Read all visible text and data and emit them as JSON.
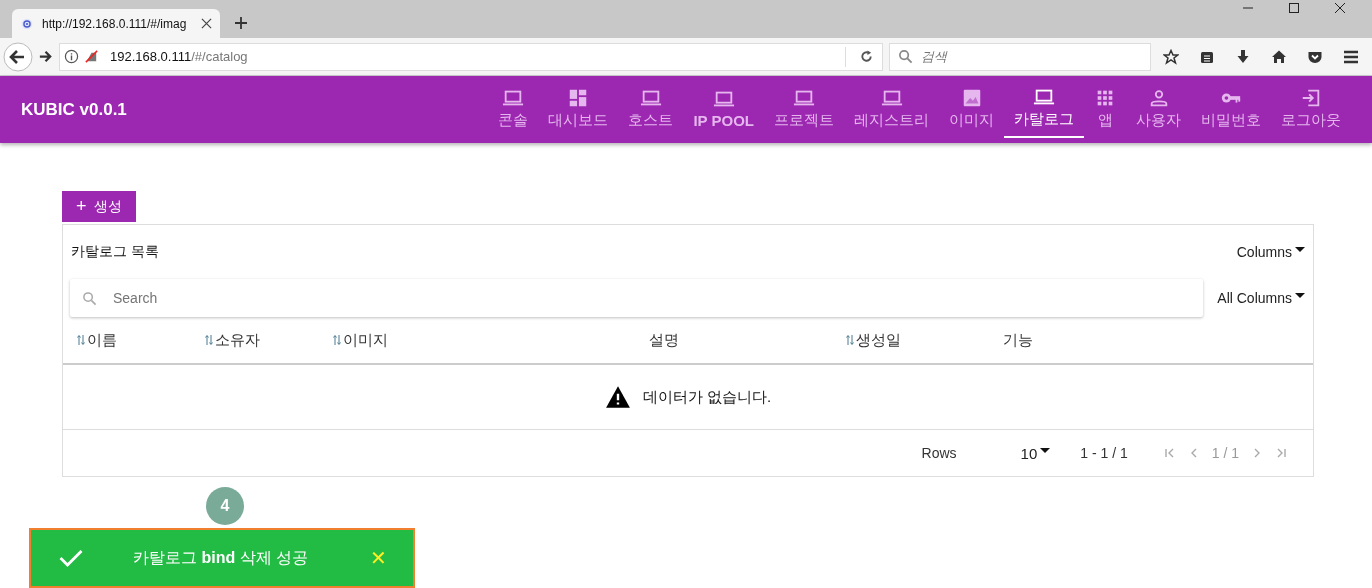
{
  "browser": {
    "tab": {
      "title": "http://192.168.0.111/#/imag"
    },
    "address": {
      "host": "192.168.0.111",
      "path": "/#/catalog"
    },
    "search": {
      "placeholder": "검색"
    }
  },
  "app": {
    "title": "KUBIC v0.0.1",
    "nav": [
      {
        "label": "콘솔",
        "kind": "laptop",
        "bold": false,
        "selected": false
      },
      {
        "label": "대시보드",
        "kind": "dashboard",
        "bold": false,
        "selected": false
      },
      {
        "label": "호스트",
        "kind": "laptop",
        "bold": false,
        "selected": false
      },
      {
        "label": "IP POOL",
        "kind": "laptop",
        "bold": true,
        "selected": false
      },
      {
        "label": "프로젝트",
        "kind": "laptop",
        "bold": false,
        "selected": false
      },
      {
        "label": "레지스트리",
        "kind": "laptop",
        "bold": false,
        "selected": false
      },
      {
        "label": "이미지",
        "kind": "image",
        "bold": false,
        "selected": false
      },
      {
        "label": "카탈로그",
        "kind": "laptop",
        "bold": false,
        "selected": true
      },
      {
        "label": "앱",
        "kind": "grid",
        "bold": false,
        "selected": false
      },
      {
        "label": "사용자",
        "kind": "person",
        "bold": false,
        "selected": false
      },
      {
        "label": "비밀번호",
        "kind": "key",
        "bold": false,
        "selected": false
      },
      {
        "label": "로그아웃",
        "kind": "logout",
        "bold": false,
        "selected": false
      }
    ]
  },
  "create_button": {
    "icon": "+",
    "label": "생성"
  },
  "table": {
    "title": "카탈로그 목록",
    "columns_menu": "Columns",
    "search": {
      "placeholder": "Search"
    },
    "filter_menu": "All Columns",
    "columns": [
      {
        "label": "이름",
        "sortable": true
      },
      {
        "label": "소유자",
        "sortable": true
      },
      {
        "label": "이미지",
        "sortable": true
      },
      {
        "label": "설명",
        "sortable": false
      },
      {
        "label": "생성일",
        "sortable": true
      },
      {
        "label": "기능",
        "sortable": false
      }
    ],
    "empty_message": "데이터가 없습니다.",
    "footer": {
      "rows_label": "Rows",
      "rows_per_page": "10",
      "range": "1 - 1 / 1",
      "page": "1 / 1"
    }
  },
  "badge": "4",
  "toast": {
    "message": "카탈로그 **bind** 삭제 성공",
    "icon_close": "✕"
  }
}
